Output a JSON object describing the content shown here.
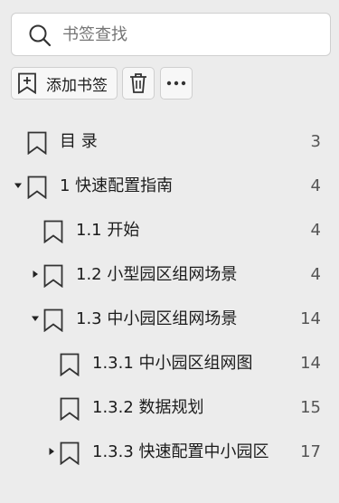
{
  "search": {
    "placeholder": "书签查找",
    "icon": "search-icon"
  },
  "toolbar": {
    "add_label": "添加书签",
    "add_icon": "add-bookmark-icon",
    "delete_icon": "trash-icon",
    "more_icon": "more-icon"
  },
  "bookmarks": [
    {
      "label": "目  录",
      "page": "3",
      "level": 0,
      "toggle": "none"
    },
    {
      "label": "1 快速配置指南",
      "page": "4",
      "level": 0,
      "toggle": "expanded"
    },
    {
      "label": "1.1 开始",
      "page": "4",
      "level": 1,
      "toggle": "none"
    },
    {
      "label": "1.2 小型园区组网场景",
      "page": "4",
      "level": 1,
      "toggle": "collapsed"
    },
    {
      "label": "1.3 中小园区组网场景",
      "page": "14",
      "level": 1,
      "toggle": "expanded"
    },
    {
      "label": "1.3.1 中小园区组网图",
      "page": "14",
      "level": 2,
      "toggle": "none"
    },
    {
      "label": "1.3.2 数据规划",
      "page": "15",
      "level": 2,
      "toggle": "none"
    },
    {
      "label": "1.3.3 快速配置中小园区",
      "page": "17",
      "level": 2,
      "toggle": "collapsed"
    }
  ]
}
